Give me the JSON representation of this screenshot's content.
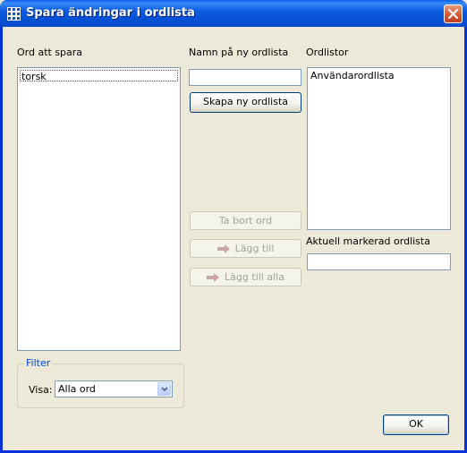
{
  "window": {
    "title": "Spara ändringar i ordlista"
  },
  "left": {
    "words_label": "Ord att spara",
    "words": [
      "torsk"
    ],
    "filter": {
      "legend": "Filter",
      "show_label": "Visa:",
      "selected": "Alla ord"
    }
  },
  "middle": {
    "new_list_label": "Namn på ny ordlista",
    "new_list_value": "",
    "create_button": "Skapa ny ordlista",
    "remove_button": "Ta bort ord",
    "add_button": "Lägg till",
    "add_all_button": "Lägg till alla"
  },
  "right": {
    "lists_label": "Ordlistor",
    "lists": [
      "Användarordlista"
    ],
    "current_label": "Aktuell markerad ordlista",
    "current_value": ""
  },
  "footer": {
    "ok_button": "OK"
  },
  "colors": {
    "titlebar": "#0a5ce0",
    "window_bg": "#ece9d8",
    "group_legend": "#0046d5"
  }
}
